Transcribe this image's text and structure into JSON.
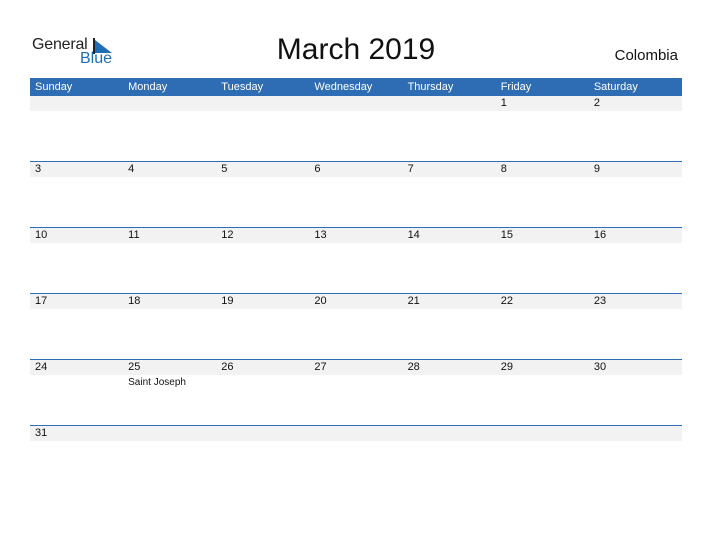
{
  "logo": {
    "word1": "General",
    "word2": "Blue",
    "brand_color": "#1f6db5",
    "icon": "flag-triangle-icon"
  },
  "title": "March 2019",
  "country": "Colombia",
  "colors": {
    "header_bg": "#2e6db4",
    "header_text": "#ffffff",
    "day_strip_bg": "#f2f2f2"
  },
  "weekdays": [
    "Sunday",
    "Monday",
    "Tuesday",
    "Wednesday",
    "Thursday",
    "Friday",
    "Saturday"
  ],
  "weeks": [
    {
      "days": [
        "",
        "",
        "",
        "",
        "",
        "1",
        "2"
      ],
      "events": [
        "",
        "",
        "",
        "",
        "",
        "",
        ""
      ]
    },
    {
      "days": [
        "3",
        "4",
        "5",
        "6",
        "7",
        "8",
        "9"
      ],
      "events": [
        "",
        "",
        "",
        "",
        "",
        "",
        ""
      ]
    },
    {
      "days": [
        "10",
        "11",
        "12",
        "13",
        "14",
        "15",
        "16"
      ],
      "events": [
        "",
        "",
        "",
        "",
        "",
        "",
        ""
      ]
    },
    {
      "days": [
        "17",
        "18",
        "19",
        "20",
        "21",
        "22",
        "23"
      ],
      "events": [
        "",
        "",
        "",
        "",
        "",
        "",
        ""
      ]
    },
    {
      "days": [
        "24",
        "25",
        "26",
        "27",
        "28",
        "29",
        "30"
      ],
      "events": [
        "",
        "Saint Joseph",
        "",
        "",
        "",
        "",
        ""
      ]
    },
    {
      "days": [
        "31",
        "",
        "",
        "",
        "",
        "",
        ""
      ],
      "events": [
        "",
        "",
        "",
        "",
        "",
        "",
        ""
      ]
    }
  ]
}
